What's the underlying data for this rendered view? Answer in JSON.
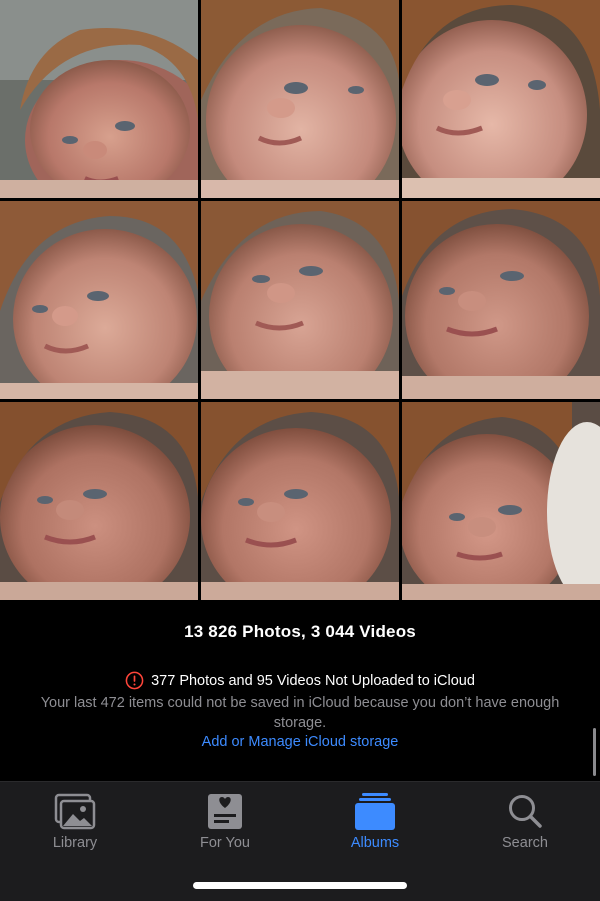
{
  "library": {
    "photos": [
      {
        "name": "photo-1"
      },
      {
        "name": "photo-2"
      },
      {
        "name": "photo-3"
      },
      {
        "name": "photo-4"
      },
      {
        "name": "photo-5"
      },
      {
        "name": "photo-6"
      },
      {
        "name": "photo-7"
      },
      {
        "name": "photo-8"
      },
      {
        "name": "photo-9"
      }
    ]
  },
  "summary": {
    "counts": "13 826 Photos, 3 044 Videos",
    "warning_icon": "exclamation-circle-icon",
    "warning": "377 Photos and 95 Videos Not Uploaded to iCloud",
    "detail": "Your last 472 items could not be saved in iCloud because you don’t have enough storage.",
    "manage_link": "Add or Manage iCloud storage"
  },
  "tabs": [
    {
      "label": "Library",
      "icon": "photo-library-icon",
      "active": false
    },
    {
      "label": "For You",
      "icon": "for-you-icon",
      "active": false
    },
    {
      "label": "Albums",
      "icon": "albums-icon",
      "active": true
    },
    {
      "label": "Search",
      "icon": "magnifier-icon",
      "active": false
    }
  ],
  "colors": {
    "accent": "#3d8bff",
    "warning": "#ff453a",
    "tab_inactive": "#8e8e93",
    "tabbar_bg": "#1c1c1e"
  }
}
